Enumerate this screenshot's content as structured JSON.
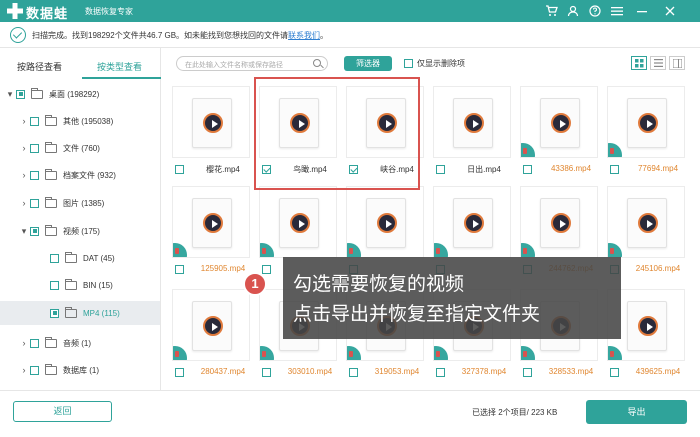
{
  "titlebar": {
    "app_name": "数据蛙",
    "app_sub": "数据恢复专家",
    "accent": "#2fa39a",
    "icons": [
      "cart-icon",
      "user-icon",
      "help-icon",
      "menu-icon",
      "minimize-icon",
      "close-icon"
    ]
  },
  "status": {
    "text": "扫描完成。找到198292个文件共46.7 GB。如未能找到您想找回的文件请",
    "link": "联系我们",
    "tail": "。"
  },
  "left": {
    "tabs": [
      "按路径查看",
      "按类型查看"
    ],
    "active_tab": 1,
    "tree": [
      {
        "label": "桌面 (198292)",
        "arrow": "▾",
        "state": "partial",
        "level": 0
      },
      {
        "label": "其他 (195038)",
        "arrow": "›",
        "state": "none",
        "level": 1
      },
      {
        "label": "文件 (760)",
        "arrow": "›",
        "state": "none",
        "level": 1
      },
      {
        "label": "档案文件 (932)",
        "arrow": "›",
        "state": "none",
        "level": 1
      },
      {
        "label": "图片 (1385)",
        "arrow": "›",
        "state": "none",
        "level": 1
      },
      {
        "label": "视频 (175)",
        "arrow": "▾",
        "state": "partial",
        "level": 1
      },
      {
        "label": "DAT (45)",
        "arrow": "",
        "state": "none",
        "level": 2
      },
      {
        "label": "BIN (15)",
        "arrow": "",
        "state": "none",
        "level": 2
      },
      {
        "label": "MP4 (115)",
        "arrow": "",
        "state": "partial",
        "level": 2,
        "selected": true
      },
      {
        "label": "音频 (1)",
        "arrow": "›",
        "state": "none",
        "level": 1
      },
      {
        "label": "数据库 (1)",
        "arrow": "›",
        "state": "none",
        "level": 1
      }
    ]
  },
  "toolbar": {
    "search_placeholder": "在此处输入文件名称或保存路径",
    "filter_label": "筛选器",
    "deleted_only_label": "仅显示删除项"
  },
  "files": [
    {
      "name": "樱花.mp4",
      "checked": false,
      "deleted": false
    },
    {
      "name": "鸟瞰.mp4",
      "checked": true,
      "deleted": false
    },
    {
      "name": "峡谷.mp4",
      "checked": true,
      "deleted": false
    },
    {
      "name": "日出.mp4",
      "checked": false,
      "deleted": false
    },
    {
      "name": "43386.mp4",
      "checked": false,
      "deleted": true
    },
    {
      "name": "77694.mp4",
      "checked": false,
      "deleted": true
    },
    {
      "name": "125905.mp4",
      "checked": false,
      "deleted": true
    },
    {
      "name": "",
      "checked": false,
      "deleted": true
    },
    {
      "name": "",
      "checked": false,
      "deleted": true
    },
    {
      "name": "",
      "checked": false,
      "deleted": true
    },
    {
      "name": "244762.mp4",
      "checked": false,
      "deleted": true
    },
    {
      "name": "245106.mp4",
      "checked": false,
      "deleted": true
    },
    {
      "name": "280437.mp4",
      "checked": false,
      "deleted": true
    },
    {
      "name": "303010.mp4",
      "checked": false,
      "deleted": true
    },
    {
      "name": "319053.mp4",
      "checked": false,
      "deleted": true
    },
    {
      "name": "327378.mp4",
      "checked": false,
      "deleted": true
    },
    {
      "name": "328533.mp4",
      "checked": false,
      "deleted": true
    },
    {
      "name": "439625.mp4",
      "checked": false,
      "deleted": true
    }
  ],
  "tip": {
    "number": "1",
    "line1": "勾选需要恢复的视频",
    "line2": "点击导出并恢复至指定文件夹"
  },
  "bottom": {
    "back_label": "返回",
    "selection_info": "已选择 2个项目/ 223 KB",
    "export_label": "导出"
  }
}
